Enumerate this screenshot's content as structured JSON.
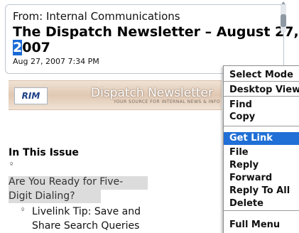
{
  "header": {
    "from": "From: Internal Communications",
    "subject_line1": "The Dispatch Newsletter – August 27,",
    "subject_cursor_char": "2",
    "subject_line2_rest": "007",
    "date": "Aug 27, 2007 7:34 PM"
  },
  "banner": {
    "logo": "RIM",
    "title": "Dispatch Newsletter",
    "subtitle": "YOUR SOURCE FOR INTERNAL NEWS & INFO"
  },
  "body": {
    "issue_heading": "In This Issue",
    "bullet_glyph": "º",
    "article_1_line1": "Are You Ready for Five-",
    "article_1_line2": "Digit Dialing?",
    "article_2_line1": "Livelink Tip: Save and",
    "article_2_line2": "Share Search Queries"
  },
  "menu": {
    "items": [
      {
        "label": "Select Mode"
      },
      {
        "label": "Desktop View"
      },
      {
        "label": "Find"
      },
      {
        "label": "Copy"
      },
      {
        "label": "Get Link",
        "selected": true
      },
      {
        "label": "File"
      },
      {
        "label": "Reply"
      },
      {
        "label": "Forward"
      },
      {
        "label": "Reply To All"
      },
      {
        "label": "Delete"
      },
      {
        "label": "Full Menu"
      }
    ]
  },
  "colors": {
    "selection": "#1f6fd6",
    "cursor": "#1a6bd6"
  }
}
